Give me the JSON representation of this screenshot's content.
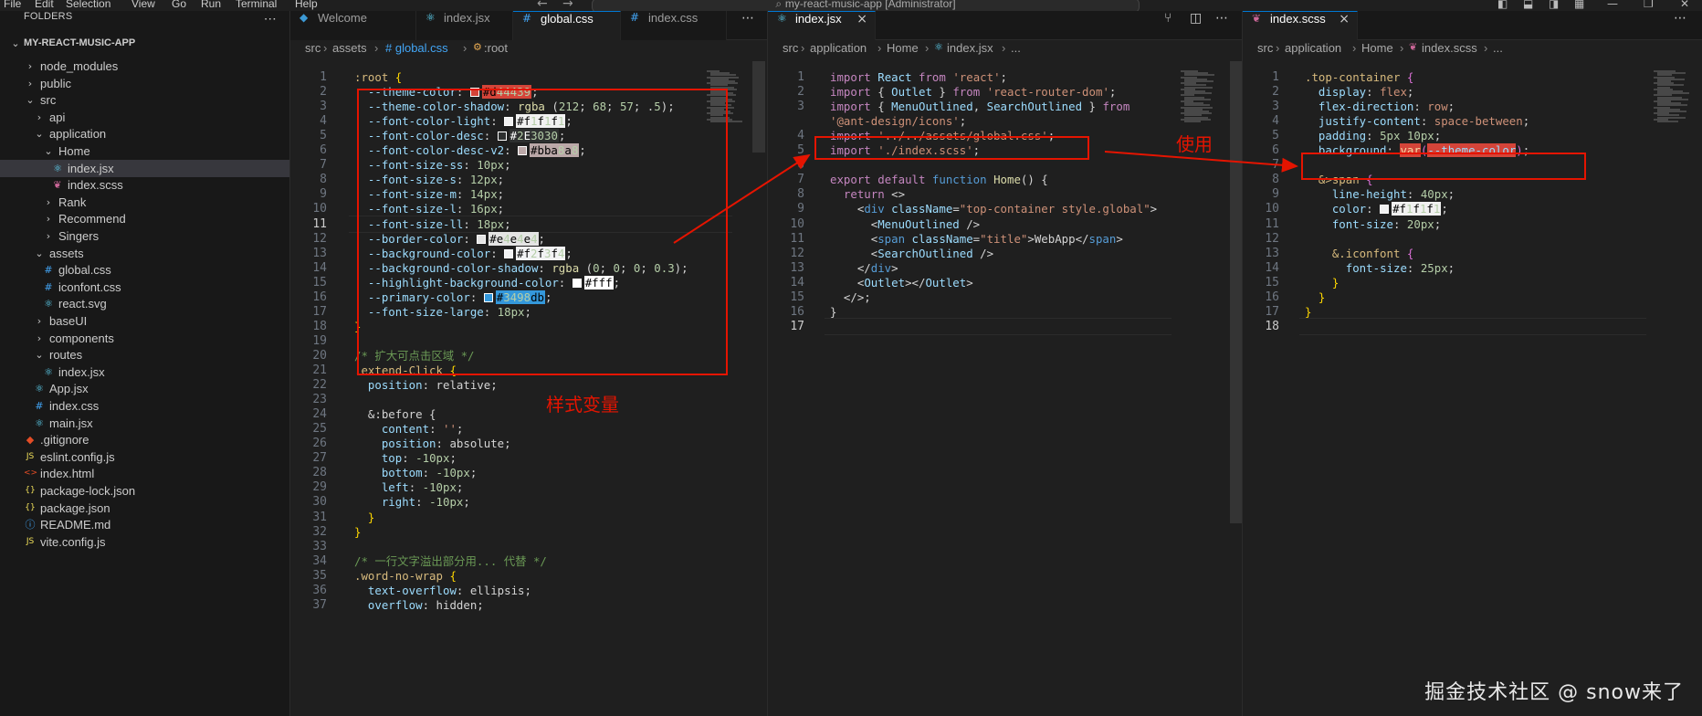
{
  "menubar": {
    "items": [
      "File",
      "Edit",
      "Selection",
      "View",
      "Go",
      "Run",
      "Terminal",
      "Help"
    ],
    "command_center": "my-react-music-app [Administrator]"
  },
  "sidebar": {
    "header": "FOLDERS",
    "root": "MY-REACT-MUSIC-APP",
    "items": [
      {
        "label": "node_modules",
        "kind": "folder-closed",
        "depth": 1
      },
      {
        "label": "public",
        "kind": "folder-closed",
        "depth": 1
      },
      {
        "label": "src",
        "kind": "folder-open",
        "depth": 1
      },
      {
        "label": "api",
        "kind": "folder-closed",
        "depth": 2
      },
      {
        "label": "application",
        "kind": "folder-open",
        "depth": 2
      },
      {
        "label": "Home",
        "kind": "folder-open",
        "depth": 3
      },
      {
        "label": "index.jsx",
        "kind": "jsx",
        "depth": 4,
        "selected": true
      },
      {
        "label": "index.scss",
        "kind": "scss",
        "depth": 4
      },
      {
        "label": "Rank",
        "kind": "folder-closed",
        "depth": 3
      },
      {
        "label": "Recommend",
        "kind": "folder-closed",
        "depth": 3
      },
      {
        "label": "Singers",
        "kind": "folder-closed",
        "depth": 3
      },
      {
        "label": "assets",
        "kind": "folder-open",
        "depth": 2
      },
      {
        "label": "global.css",
        "kind": "css",
        "depth": 3
      },
      {
        "label": "iconfont.css",
        "kind": "css",
        "depth": 3
      },
      {
        "label": "react.svg",
        "kind": "jsx",
        "depth": 3
      },
      {
        "label": "baseUI",
        "kind": "folder-closed",
        "depth": 2
      },
      {
        "label": "components",
        "kind": "folder-closed",
        "depth": 2
      },
      {
        "label": "routes",
        "kind": "folder-open",
        "depth": 2
      },
      {
        "label": "index.jsx",
        "kind": "jsx",
        "depth": 3
      },
      {
        "label": "App.jsx",
        "kind": "jsx",
        "depth": 2
      },
      {
        "label": "index.css",
        "kind": "css",
        "depth": 2
      },
      {
        "label": "main.jsx",
        "kind": "jsx",
        "depth": 2
      },
      {
        "label": ".gitignore",
        "kind": "git",
        "depth": 1
      },
      {
        "label": "eslint.config.js",
        "kind": "js",
        "depth": 1
      },
      {
        "label": "index.html",
        "kind": "html",
        "depth": 1
      },
      {
        "label": "package-lock.json",
        "kind": "json",
        "depth": 1
      },
      {
        "label": "package.json",
        "kind": "json",
        "depth": 1
      },
      {
        "label": "README.md",
        "kind": "info",
        "depth": 1
      },
      {
        "label": "vite.config.js",
        "kind": "js",
        "depth": 1
      }
    ]
  },
  "group1": {
    "tabs": [
      {
        "label": "Welcome",
        "icon": "vscode-icon"
      },
      {
        "label": "index.jsx",
        "icon": "react-icon"
      },
      {
        "label": "global.css",
        "icon": "css-icon",
        "active": true
      },
      {
        "label": "index.css",
        "icon": "css-icon"
      }
    ],
    "breadcrumb": [
      "src",
      "assets",
      "# global.css",
      ":root"
    ],
    "lines": [
      ":root {",
      "  --theme-color: #d44439;",
      "  --theme-color-shadow: rgba (212; 68; 57; .5);",
      "  --font-color-light: #f1f1f1;",
      "  --font-color-desc: #2E3030;",
      "  --font-color-desc-v2: #bba8a8;",
      "  --font-size-ss: 10px;",
      "  --font-size-s: 12px;",
      "  --font-size-m: 14px;",
      "  --font-size-l: 16px;",
      "  --font-size-ll: 18px;",
      "  --border-color: #e4e4e4;",
      "  --background-color: #f2f3f4;",
      "  --background-color-shadow: rgba (0; 0; 0; 0.3);",
      "  --highlight-background-color: #fff;",
      "  --primary-color: #3498db;",
      "  --font-size-large: 18px;",
      "}",
      "",
      "/* 扩大可点击区域 */",
      ".extend-Click {",
      "  position: relative;",
      "",
      "  &:before {",
      "    content: '';",
      "    position: absolute;",
      "    top: -10px;",
      "    bottom: -10px;",
      "    left: -10px;",
      "    right: -10px;",
      "  }",
      "}",
      "",
      "/* 一行文字溢出部分用... 代替 */",
      ".word-no-wrap {",
      "  text-overflow: ellipsis;",
      "  overflow: hidden;"
    ],
    "annotation": "样式变量"
  },
  "group2": {
    "tabs": [
      {
        "label": "index.jsx",
        "icon": "react-icon",
        "active": true
      }
    ],
    "breadcrumb": [
      "src",
      "application",
      "Home",
      "index.jsx",
      "..."
    ],
    "lines": [
      "import React from 'react';",
      "import { Outlet } from 'react-router-dom';",
      "import { MenuOutlined, SearchOutlined } from",
      "'@ant-design/icons';",
      "import '../../assets/global.css';",
      "import './index.scss';",
      "",
      "export default function Home() {",
      "  return <>",
      "    <div className=\"top-container style.global\">",
      "      <MenuOutlined />",
      "      <span className=\"title\">WebApp</span>",
      "      <SearchOutlined />",
      "    </div>",
      "    <Outlet></Outlet>",
      "  </>;",
      "}",
      ""
    ],
    "line_numbers": [
      "1",
      "2",
      "3",
      "",
      "4",
      "5",
      "6",
      "7",
      "8",
      "9",
      "10",
      "11",
      "12",
      "13",
      "14",
      "15",
      "16",
      "17"
    ],
    "annotation": "使用"
  },
  "group3": {
    "tabs": [
      {
        "label": "index.scss",
        "icon": "sass-icon",
        "active": true
      }
    ],
    "breadcrumb": [
      "src",
      "application",
      "Home",
      "index.scss",
      "..."
    ],
    "lines": [
      ".top-container {",
      "  display: flex;",
      "  flex-direction: row;",
      "  justify-content: space-between;",
      "  padding: 5px 10px;",
      "  background: var(--theme-color);",
      "",
      "  &>span {",
      "    line-height: 40px;",
      "    color: #f1f1f1;",
      "    font-size: 20px;",
      "",
      "    &.iconfont {",
      "      font-size: 25px;",
      "    }",
      "  }",
      "}",
      ""
    ]
  },
  "watermark": "掘金技术社区 @ snow来了",
  "colors": {
    "theme": "#d44439",
    "desc": "#2E3030",
    "desc_v2": "#bba8a8",
    "light": "#f1f1f1",
    "border": "#e4e4e4",
    "bg": "#f2f3f4",
    "highlight": "#fff",
    "primary": "#3498db",
    "annotation_red": "#e51400"
  }
}
